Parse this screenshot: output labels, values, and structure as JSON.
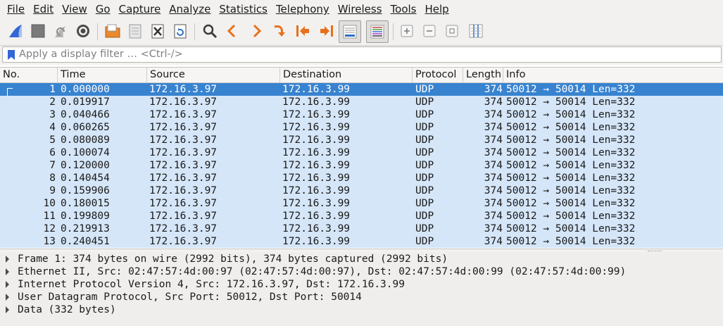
{
  "menu": [
    {
      "label": "File",
      "id": "file"
    },
    {
      "label": "Edit",
      "id": "edit"
    },
    {
      "label": "View",
      "id": "view"
    },
    {
      "label": "Go",
      "id": "go"
    },
    {
      "label": "Capture",
      "id": "capture"
    },
    {
      "label": "Analyze",
      "id": "analyze"
    },
    {
      "label": "Statistics",
      "id": "statistics"
    },
    {
      "label": "Telephony",
      "id": "telephony"
    },
    {
      "label": "Wireless",
      "id": "wireless"
    },
    {
      "label": "Tools",
      "id": "tools"
    },
    {
      "label": "Help",
      "id": "help"
    }
  ],
  "toolbar": {
    "icons": [
      "shark-fin-icon",
      "stop-icon",
      "restart-capture-icon",
      "capture-options-icon",
      "open-file-icon",
      "save-file-icon",
      "close-file-icon",
      "reload-file-icon",
      "find-packet-icon",
      "go-back-icon",
      "go-forward-icon",
      "go-to-packet-icon",
      "first-packet-icon",
      "last-packet-icon",
      "auto-scroll-icon",
      "colorize-icon",
      "zoom-in-icon",
      "zoom-out-icon",
      "normal-size-icon",
      "resize-columns-icon"
    ]
  },
  "filter": {
    "placeholder": "Apply a display filter … <Ctrl-/>"
  },
  "packet_list": {
    "columns": [
      "No.",
      "Time",
      "Source",
      "Destination",
      "Protocol",
      "Length",
      "Info"
    ],
    "rows": [
      {
        "no": "1",
        "time": "0.000000",
        "source": "172.16.3.97",
        "destination": "172.16.3.99",
        "protocol": "UDP",
        "length": "374",
        "info": "50012 → 50014 Len=332"
      },
      {
        "no": "2",
        "time": "0.019917",
        "source": "172.16.3.97",
        "destination": "172.16.3.99",
        "protocol": "UDP",
        "length": "374",
        "info": "50012 → 50014 Len=332"
      },
      {
        "no": "3",
        "time": "0.040466",
        "source": "172.16.3.97",
        "destination": "172.16.3.99",
        "protocol": "UDP",
        "length": "374",
        "info": "50012 → 50014 Len=332"
      },
      {
        "no": "4",
        "time": "0.060265",
        "source": "172.16.3.97",
        "destination": "172.16.3.99",
        "protocol": "UDP",
        "length": "374",
        "info": "50012 → 50014 Len=332"
      },
      {
        "no": "5",
        "time": "0.080089",
        "source": "172.16.3.97",
        "destination": "172.16.3.99",
        "protocol": "UDP",
        "length": "374",
        "info": "50012 → 50014 Len=332"
      },
      {
        "no": "6",
        "time": "0.100074",
        "source": "172.16.3.97",
        "destination": "172.16.3.99",
        "protocol": "UDP",
        "length": "374",
        "info": "50012 → 50014 Len=332"
      },
      {
        "no": "7",
        "time": "0.120000",
        "source": "172.16.3.97",
        "destination": "172.16.3.99",
        "protocol": "UDP",
        "length": "374",
        "info": "50012 → 50014 Len=332"
      },
      {
        "no": "8",
        "time": "0.140454",
        "source": "172.16.3.97",
        "destination": "172.16.3.99",
        "protocol": "UDP",
        "length": "374",
        "info": "50012 → 50014 Len=332"
      },
      {
        "no": "9",
        "time": "0.159906",
        "source": "172.16.3.97",
        "destination": "172.16.3.99",
        "protocol": "UDP",
        "length": "374",
        "info": "50012 → 50014 Len=332"
      },
      {
        "no": "10",
        "time": "0.180015",
        "source": "172.16.3.97",
        "destination": "172.16.3.99",
        "protocol": "UDP",
        "length": "374",
        "info": "50012 → 50014 Len=332"
      },
      {
        "no": "11",
        "time": "0.199809",
        "source": "172.16.3.97",
        "destination": "172.16.3.99",
        "protocol": "UDP",
        "length": "374",
        "info": "50012 → 50014 Len=332"
      },
      {
        "no": "12",
        "time": "0.219913",
        "source": "172.16.3.97",
        "destination": "172.16.3.99",
        "protocol": "UDP",
        "length": "374",
        "info": "50012 → 50014 Len=332"
      },
      {
        "no": "13",
        "time": "0.240451",
        "source": "172.16.3.97",
        "destination": "172.16.3.99",
        "protocol": "UDP",
        "length": "374",
        "info": "50012 → 50014 Len=332"
      }
    ],
    "selected_row": "1"
  },
  "details": [
    "Frame 1: 374 bytes on wire (2992 bits), 374 bytes captured (2992 bits)",
    "Ethernet II, Src: 02:47:57:4d:00:97 (02:47:57:4d:00:97), Dst: 02:47:57:4d:00:99 (02:47:57:4d:00:99)",
    "Internet Protocol Version 4, Src: 172.16.3.97, Dst: 172.16.3.99",
    "User Datagram Protocol, Src Port: 50012, Dst Port: 50014",
    "Data (332 bytes)"
  ],
  "colors": {
    "udp_row": "#d5e6f8",
    "selected_row": "#3883d0",
    "chrome": "#f2f1f0",
    "shark_fin": "#3367d6",
    "arrows": "#e8701a"
  }
}
